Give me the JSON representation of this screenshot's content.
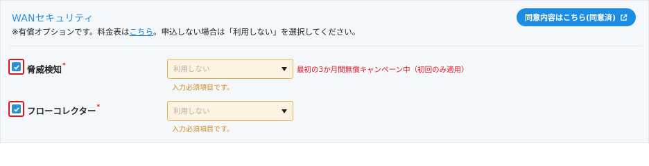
{
  "section": {
    "title": "WANセキュリティ",
    "note_prefix": "※有償オプションです。料金表は",
    "note_link": "こちら",
    "note_suffix": "。申込しない場合は「利用しない」を選択してください。",
    "agree_button": "同意内容はこちら(同意済)"
  },
  "rows": [
    {
      "label": "脅威検知",
      "required_mark": "*",
      "checked": true,
      "select_value": "利用しない",
      "required_message": "入力必須項目です。",
      "campaign_text": "最初の3か月間無償キャンペーン中（初回のみ適用）"
    },
    {
      "label": "フローコレクター",
      "required_mark": "*",
      "checked": true,
      "select_value": "利用しない",
      "required_message": "入力必須項目です。"
    }
  ],
  "colors": {
    "accent": "#1d8de4",
    "error": "#e0141b",
    "warning_text": "#d0891c",
    "select_bg": "#fdf3e3"
  },
  "icons": {
    "agree_button_icon": "external-link-icon",
    "checkbox_icon": "check-icon",
    "select_icon": "caret-down-icon"
  }
}
